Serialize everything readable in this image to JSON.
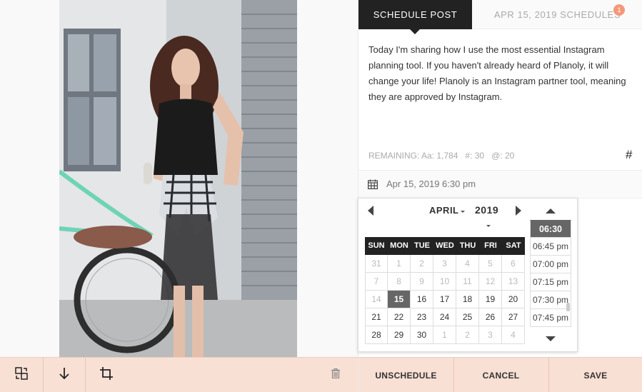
{
  "tabs": {
    "active_label": "SCHEDULE POST",
    "second_label": "APR 15, 2019 SCHEDULES",
    "badge_count": "1"
  },
  "caption_text": "Today I'm sharing how I use the most essential Instagram planning tool. If you haven't already heard of Planoly, it will change your life! Planoly is an Instagram partner tool, meaning they are approved by Instagram.",
  "remaining": {
    "label": "REMAINING:",
    "chars": "Aa: 1,784",
    "hashtags": "#: 30",
    "mentions": "@: 20"
  },
  "hashtag_button": "#",
  "schedule_date": "Apr 15, 2019 6:30 pm",
  "picker": {
    "month": "APRIL",
    "year": "2019",
    "weekdays": [
      "SUN",
      "MON",
      "TUE",
      "WED",
      "THU",
      "FRI",
      "SAT"
    ],
    "weeks": [
      [
        "31",
        "1",
        "2",
        "3",
        "4",
        "5",
        "6"
      ],
      [
        "7",
        "8",
        "9",
        "10",
        "11",
        "12",
        "13"
      ],
      [
        "14",
        "15",
        "16",
        "17",
        "18",
        "19",
        "20"
      ],
      [
        "21",
        "22",
        "23",
        "24",
        "25",
        "26",
        "27"
      ],
      [
        "28",
        "29",
        "30",
        "1",
        "2",
        "3",
        "4"
      ]
    ],
    "selected_day": "15",
    "times": [
      "06:30",
      "06:45 pm",
      "07:00 pm",
      "07:15 pm",
      "07:30 pm",
      "07:45 pm"
    ],
    "selected_time": "06:30"
  },
  "bottom_actions": {
    "unschedule": "UNSCHEDULE",
    "cancel": "CANCEL",
    "save": "SAVE"
  },
  "colors": {
    "toolbar_bg": "#f9e0d4",
    "tab_active_bg": "#222222",
    "badge_bg": "#f4987a",
    "selected_bg": "#666666"
  },
  "icons": {
    "swap": "swap-icon",
    "download": "arrow-down-icon",
    "crop": "crop-icon",
    "trash": "trash-icon",
    "calendar": "calendar-icon"
  }
}
